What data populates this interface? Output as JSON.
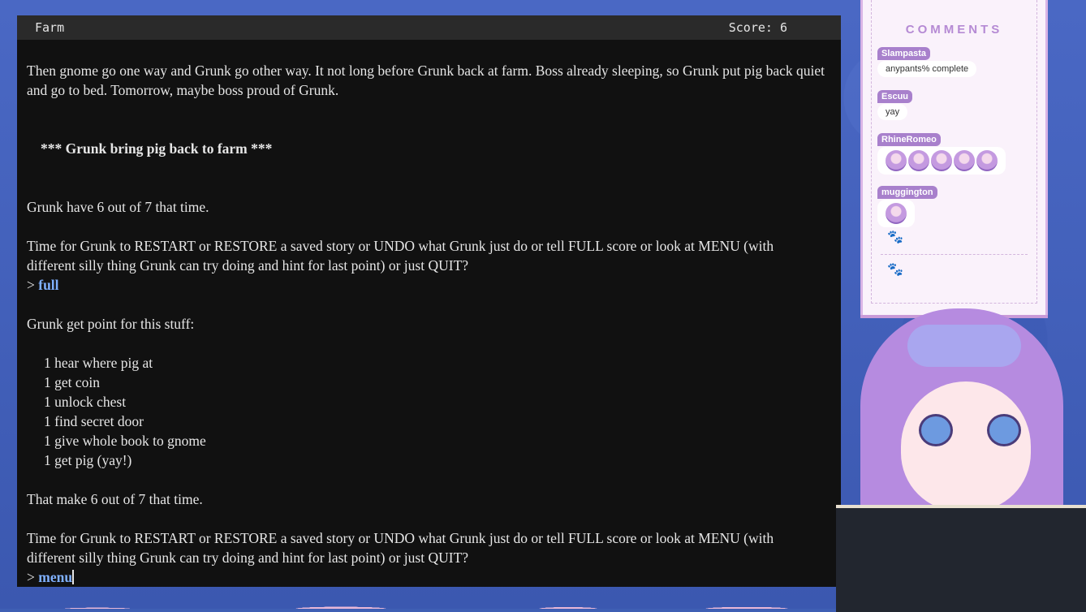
{
  "game": {
    "location": "Farm",
    "score": "Score: 6",
    "para1": "Then gnome go one way and Grunk go other way. It not long before Grunk back at farm. Boss already sleeping, so Grunk put pig back quiet and go to bed. Tomorrow, maybe boss proud of Grunk.",
    "heading": "***  Grunk bring pig back to farm  ***",
    "para2": "Grunk have 6 out of 7 that time.",
    "para3": "Time for Grunk to RESTART or RESTORE a saved story or UNDO what Grunk just do or tell FULL score or look at MENU (with different silly thing Grunk can try doing and hint for last point) or just QUIT?",
    "prompt": ">",
    "cmd1": "full",
    "para4": "Grunk get point for this stuff:",
    "points": [
      "1 hear where pig at",
      "1 get coin",
      "1 unlock chest",
      "1 find secret door",
      "1 give whole book to gnome",
      "1 get pig (yay!)"
    ],
    "para5": "That make 6 out of 7 that time.",
    "para6": "Time for Grunk to RESTART or RESTORE a saved story or UNDO what Grunk just do or tell FULL score or look at MENU (with different silly thing Grunk can try doing and hint for last point) or just QUIT?",
    "cmd2": "menu"
  },
  "comments": {
    "title": "COMMENTS",
    "items": [
      {
        "user": "Slampasta",
        "text": "anypants% complete"
      },
      {
        "user": "Escuu",
        "text": "yay"
      },
      {
        "user": "RhineRomeo",
        "emotes": 5
      },
      {
        "user": "muggington",
        "emotes": 1
      }
    ]
  },
  "colors": {
    "command": "#7fb0ff",
    "accent": "#a880cc"
  }
}
